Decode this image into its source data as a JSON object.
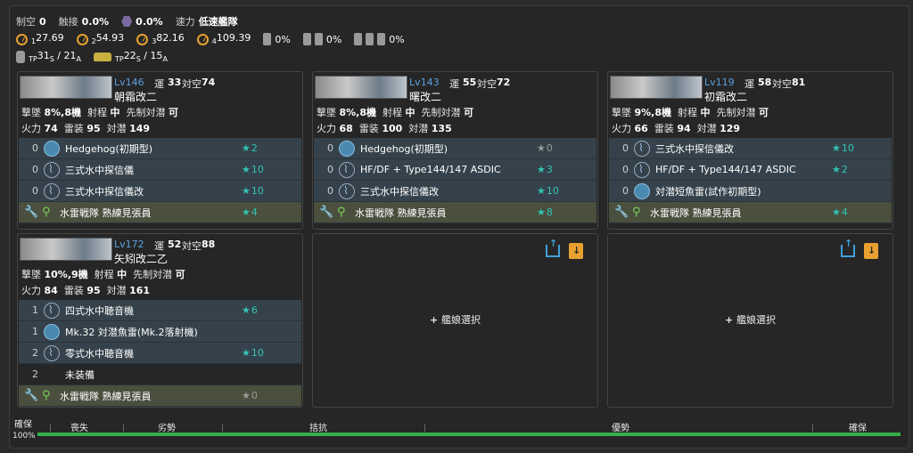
{
  "stats": {
    "air_label": "制空",
    "air_value": "0",
    "contact_label": "触接",
    "contact_value": "0.0%",
    "aa_value": "0.0%",
    "speed_label": "速力",
    "speed_value": "低速艦隊",
    "los": [
      {
        "prefix": "1",
        "value": "27.69"
      },
      {
        "prefix": "2",
        "value": "54.93"
      },
      {
        "prefix": "3",
        "value": "82.16"
      },
      {
        "prefix": "4",
        "value": "109.39"
      }
    ],
    "pct1": "0%",
    "pct2": "0%",
    "pct3": "0%",
    "tp_s_main": "31",
    "tp_s_sub": "S",
    "tp_a_main": "/ 21",
    "tp_a_sub": "A",
    "tp2_s_main": "22",
    "tp2_s_sub": "S",
    "tp2_a_main": "/ 15",
    "tp2_a_sub": "A",
    "tp_prefix": "TP"
  },
  "ships": [
    {
      "lv": "Lv146",
      "luck_label": "運",
      "luck": "33",
      "asw_label": "対空",
      "asw": "74",
      "name": "朝霜改二",
      "line1": {
        "a": "撃墜",
        "b": "8%,8機",
        "c": "射程",
        "d": "中",
        "e": "先制対潜",
        "f": "可"
      },
      "line2": {
        "a": "火力",
        "b": "74",
        "c": "雷装",
        "d": "95",
        "e": "対潜",
        "f": "149"
      },
      "equips": [
        {
          "slot": "0",
          "name": "Hedgehog(初期型)",
          "star": "2",
          "icon": "depth"
        },
        {
          "slot": "0",
          "name": "三式水中探信儀",
          "star": "10",
          "icon": "sonar"
        },
        {
          "slot": "0",
          "name": "三式水中探信儀改",
          "star": "10",
          "icon": "sonar"
        }
      ],
      "ex": {
        "name": "水雷戦隊 熟練見張員",
        "star": "4"
      }
    },
    {
      "lv": "Lv143",
      "luck_label": "運",
      "luck": "55",
      "asw_label": "対空",
      "asw": "72",
      "name": "曙改二",
      "line1": {
        "a": "撃墜",
        "b": "8%,8機",
        "c": "射程",
        "d": "中",
        "e": "先制対潜",
        "f": "可"
      },
      "line2": {
        "a": "火力",
        "b": "68",
        "c": "雷装",
        "d": "100",
        "e": "対潜",
        "f": "135"
      },
      "equips": [
        {
          "slot": "0",
          "name": "Hedgehog(初期型)",
          "star": "0",
          "icon": "depth"
        },
        {
          "slot": "0",
          "name": "HF/DF + Type144/147 ASDIC",
          "star": "3",
          "icon": "sonar"
        },
        {
          "slot": "0",
          "name": "三式水中探信儀改",
          "star": "10",
          "icon": "sonar"
        }
      ],
      "ex": {
        "name": "水雷戦隊 熟練見張員",
        "star": "8"
      }
    },
    {
      "lv": "Lv119",
      "luck_label": "運",
      "luck": "58",
      "asw_label": "対空",
      "asw": "81",
      "name": "初霜改二",
      "line1": {
        "a": "撃墜",
        "b": "9%,8機",
        "c": "射程",
        "d": "中",
        "e": "先制対潜",
        "f": "可"
      },
      "line2": {
        "a": "火力",
        "b": "66",
        "c": "雷装",
        "d": "94",
        "e": "対潜",
        "f": "129"
      },
      "equips": [
        {
          "slot": "0",
          "name": "三式水中探信儀改",
          "star": "10",
          "icon": "sonar"
        },
        {
          "slot": "0",
          "name": "HF/DF + Type144/147 ASDIC",
          "star": "2",
          "icon": "sonar"
        },
        {
          "slot": "0",
          "name": "対潜短魚雷(試作初期型)",
          "star": "",
          "icon": "depth"
        }
      ],
      "ex": {
        "name": "水雷戦隊 熟練見張員",
        "star": "4"
      }
    },
    {
      "lv": "Lv172",
      "luck_label": "運",
      "luck": "52",
      "asw_label": "対空",
      "asw": "88",
      "name": "矢矧改二乙",
      "line1": {
        "a": "撃墜",
        "b": "10%,9機",
        "c": "射程",
        "d": "中",
        "e": "先制対潜",
        "f": "可"
      },
      "line2": {
        "a": "火力",
        "b": "84",
        "c": "雷装",
        "d": "95",
        "e": "対潜",
        "f": "161"
      },
      "equips": [
        {
          "slot": "1",
          "name": "四式水中聴音機",
          "star": "6",
          "icon": "sonar"
        },
        {
          "slot": "1",
          "name": "Mk.32 対潜魚雷(Mk.2落射機)",
          "star": "",
          "icon": "depth"
        },
        {
          "slot": "2",
          "name": "零式水中聴音機",
          "star": "10",
          "icon": "sonar"
        },
        {
          "slot": "2",
          "name": "未装備",
          "star": "",
          "icon": "none"
        }
      ],
      "ex": {
        "name": "水雷戦隊 熟練見張員",
        "star": "0"
      }
    }
  ],
  "empty_slot": {
    "label": "艦娘選択"
  },
  "bottom": {
    "left_top": "確保",
    "left_bottom": "100%",
    "labels": [
      "喪失",
      "劣勢",
      "拮抗",
      "優勢",
      "確保"
    ],
    "fill_fraction": 1.0
  }
}
